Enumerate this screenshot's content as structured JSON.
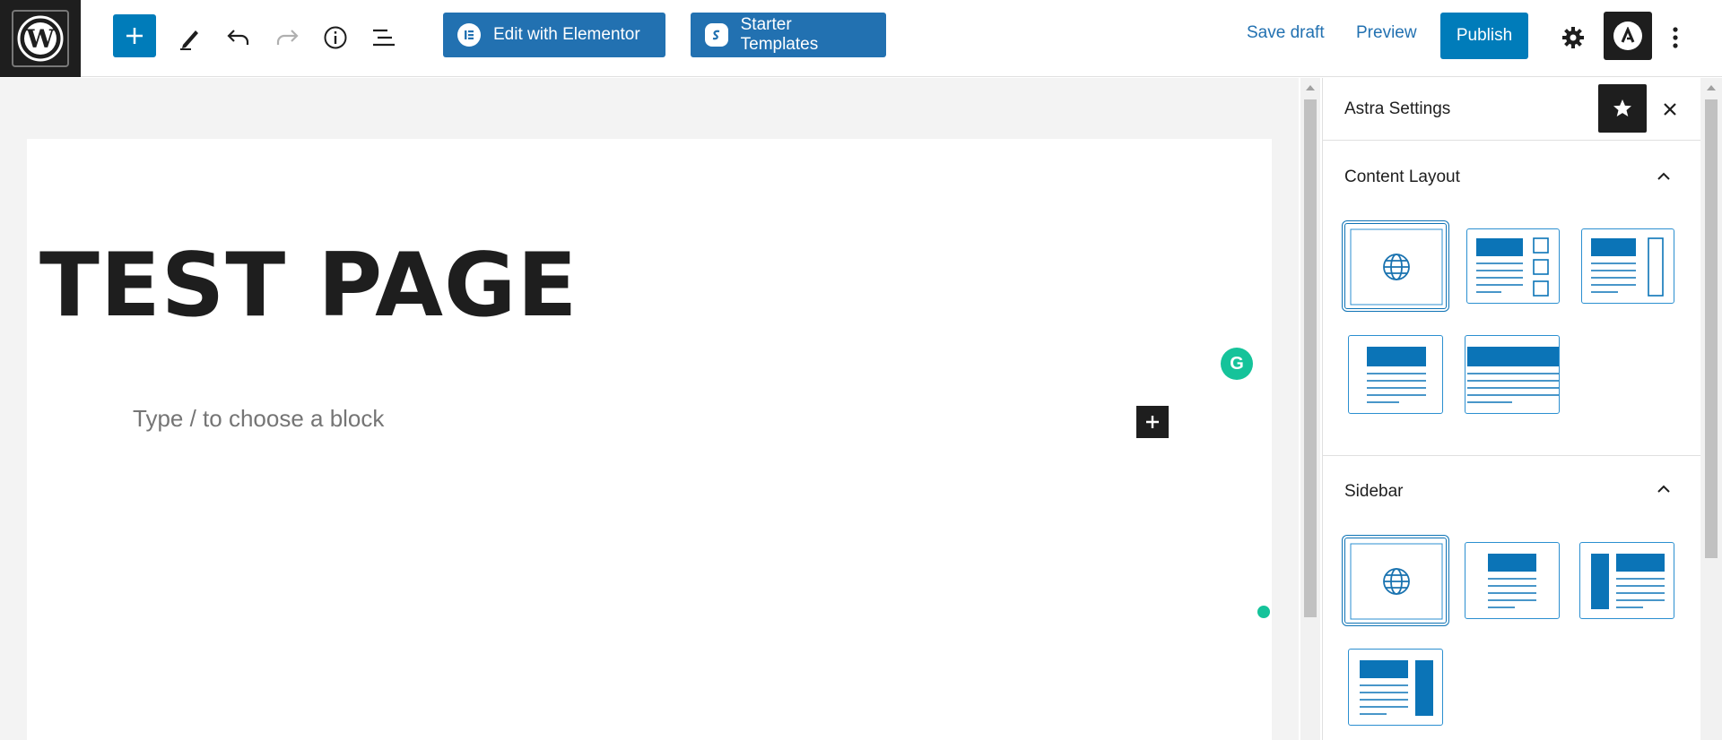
{
  "toolbar": {
    "edit_elementor": "Edit with Elementor",
    "starter_templates": "Starter Templates",
    "save_draft": "Save draft",
    "preview": "Preview",
    "publish": "Publish"
  },
  "editor": {
    "page_title": "TEST PAGE",
    "block_placeholder": "Type / to choose a block",
    "grammarly_letter": "G"
  },
  "sidebar": {
    "title": "Astra Settings",
    "sections": [
      {
        "title": "Content Layout",
        "expanded": true,
        "options": [
          "default-icon",
          "boxed-with-sidebar-icons",
          "boxed-right-bar",
          "narrow-width",
          "full-width-stretched"
        ]
      },
      {
        "title": "Sidebar",
        "expanded": true,
        "options": [
          "default-icon",
          "no-sidebar",
          "left-sidebar",
          "right-sidebar"
        ]
      }
    ]
  },
  "colors": {
    "accent": "#007cba",
    "dark": "#1e1e1e",
    "grammarly": "#15c39a"
  }
}
